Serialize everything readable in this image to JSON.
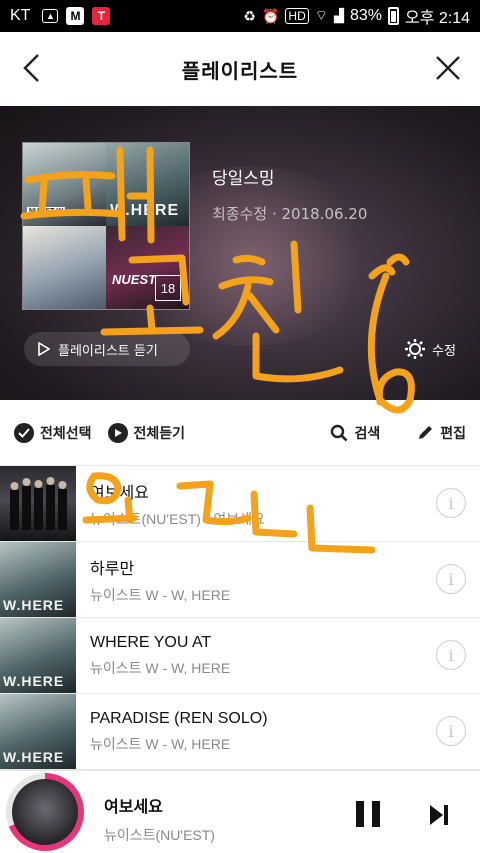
{
  "status_bar": {
    "carrier": "KT",
    "battery": "83%",
    "time": "오후 2:14",
    "hd_label": "HD",
    "app_icons": [
      {
        "name": "image-icon",
        "color": "#ffffff"
      },
      {
        "name": "melon-app-icon",
        "color": "#ffffff",
        "letter": "M"
      },
      {
        "name": "t-app-icon",
        "color": "#e8243c",
        "letter": "T"
      }
    ]
  },
  "header": {
    "title": "플레이리스트"
  },
  "playlist": {
    "name": "당일스밍",
    "updated": "최종수정 · 2018.06.20",
    "track_count": "18",
    "listen_label": "플레이리스트 듣기",
    "edit_label": "수정",
    "cover_texts": {
      "top_left_badge": "NU'EST W",
      "top_right": "W.HERE",
      "bottom_right": "NUEST"
    }
  },
  "toolbar": {
    "select_all": "전체선택",
    "play_all": "전체듣기",
    "search": "검색",
    "edit": "편집"
  },
  "tracks": [
    {
      "title": "여보세요",
      "subtitle": "뉴이스트(NU'EST) - 여보세요",
      "art": "nuest"
    },
    {
      "title": "하루만",
      "subtitle": "뉴이스트 W - W, HERE",
      "art": "where"
    },
    {
      "title": "WHERE YOU AT",
      "subtitle": "뉴이스트 W - W, HERE",
      "art": "where"
    },
    {
      "title": "PARADISE (REN SOLO)",
      "subtitle": "뉴이스트 W - W, HERE",
      "art": "where"
    }
  ],
  "thumb_text": "W.HERE",
  "player": {
    "title": "여보세요",
    "artist": "뉴이스트(NU'EST)",
    "progress": 0.69,
    "progress_color": "#e8347a"
  },
  "annotation": {
    "color": "#f5a21b"
  }
}
